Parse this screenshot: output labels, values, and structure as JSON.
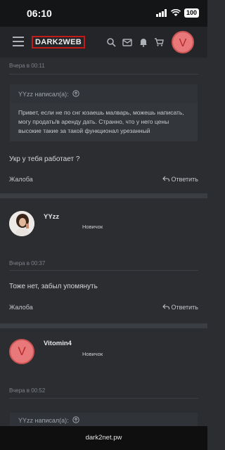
{
  "status": {
    "time": "06:10",
    "battery": "100"
  },
  "header": {
    "logo": "DARK2WEB",
    "avatar_letter": "V"
  },
  "posts": [
    {
      "timestamp": "Вчера в 00:11",
      "quote_author": "YYzz написал(а):",
      "quote_text": "Привет, если не по снг юзаешь малварь, можешь написать, могу продать/в аренду дать. Странно, что у него цены высокие такие за такой функционал урезанный",
      "message": "Укр у тебя работает ?",
      "report_label": "Жалоба",
      "reply_label": "Ответить"
    },
    {
      "author": "YYzz",
      "rank": "Новичок",
      "timestamp": "Вчера в 00:37",
      "message": "Тоже нет, забыл упомянуть",
      "report_label": "Жалоба",
      "reply_label": "Ответить"
    },
    {
      "author": "Vitomin4",
      "rank": "Новичок",
      "avatar_letter": "V",
      "timestamp": "Вчера в 00:52",
      "quote_author": "YYzz написал(а):"
    }
  ],
  "browser": {
    "url": "dark2net.pw"
  }
}
